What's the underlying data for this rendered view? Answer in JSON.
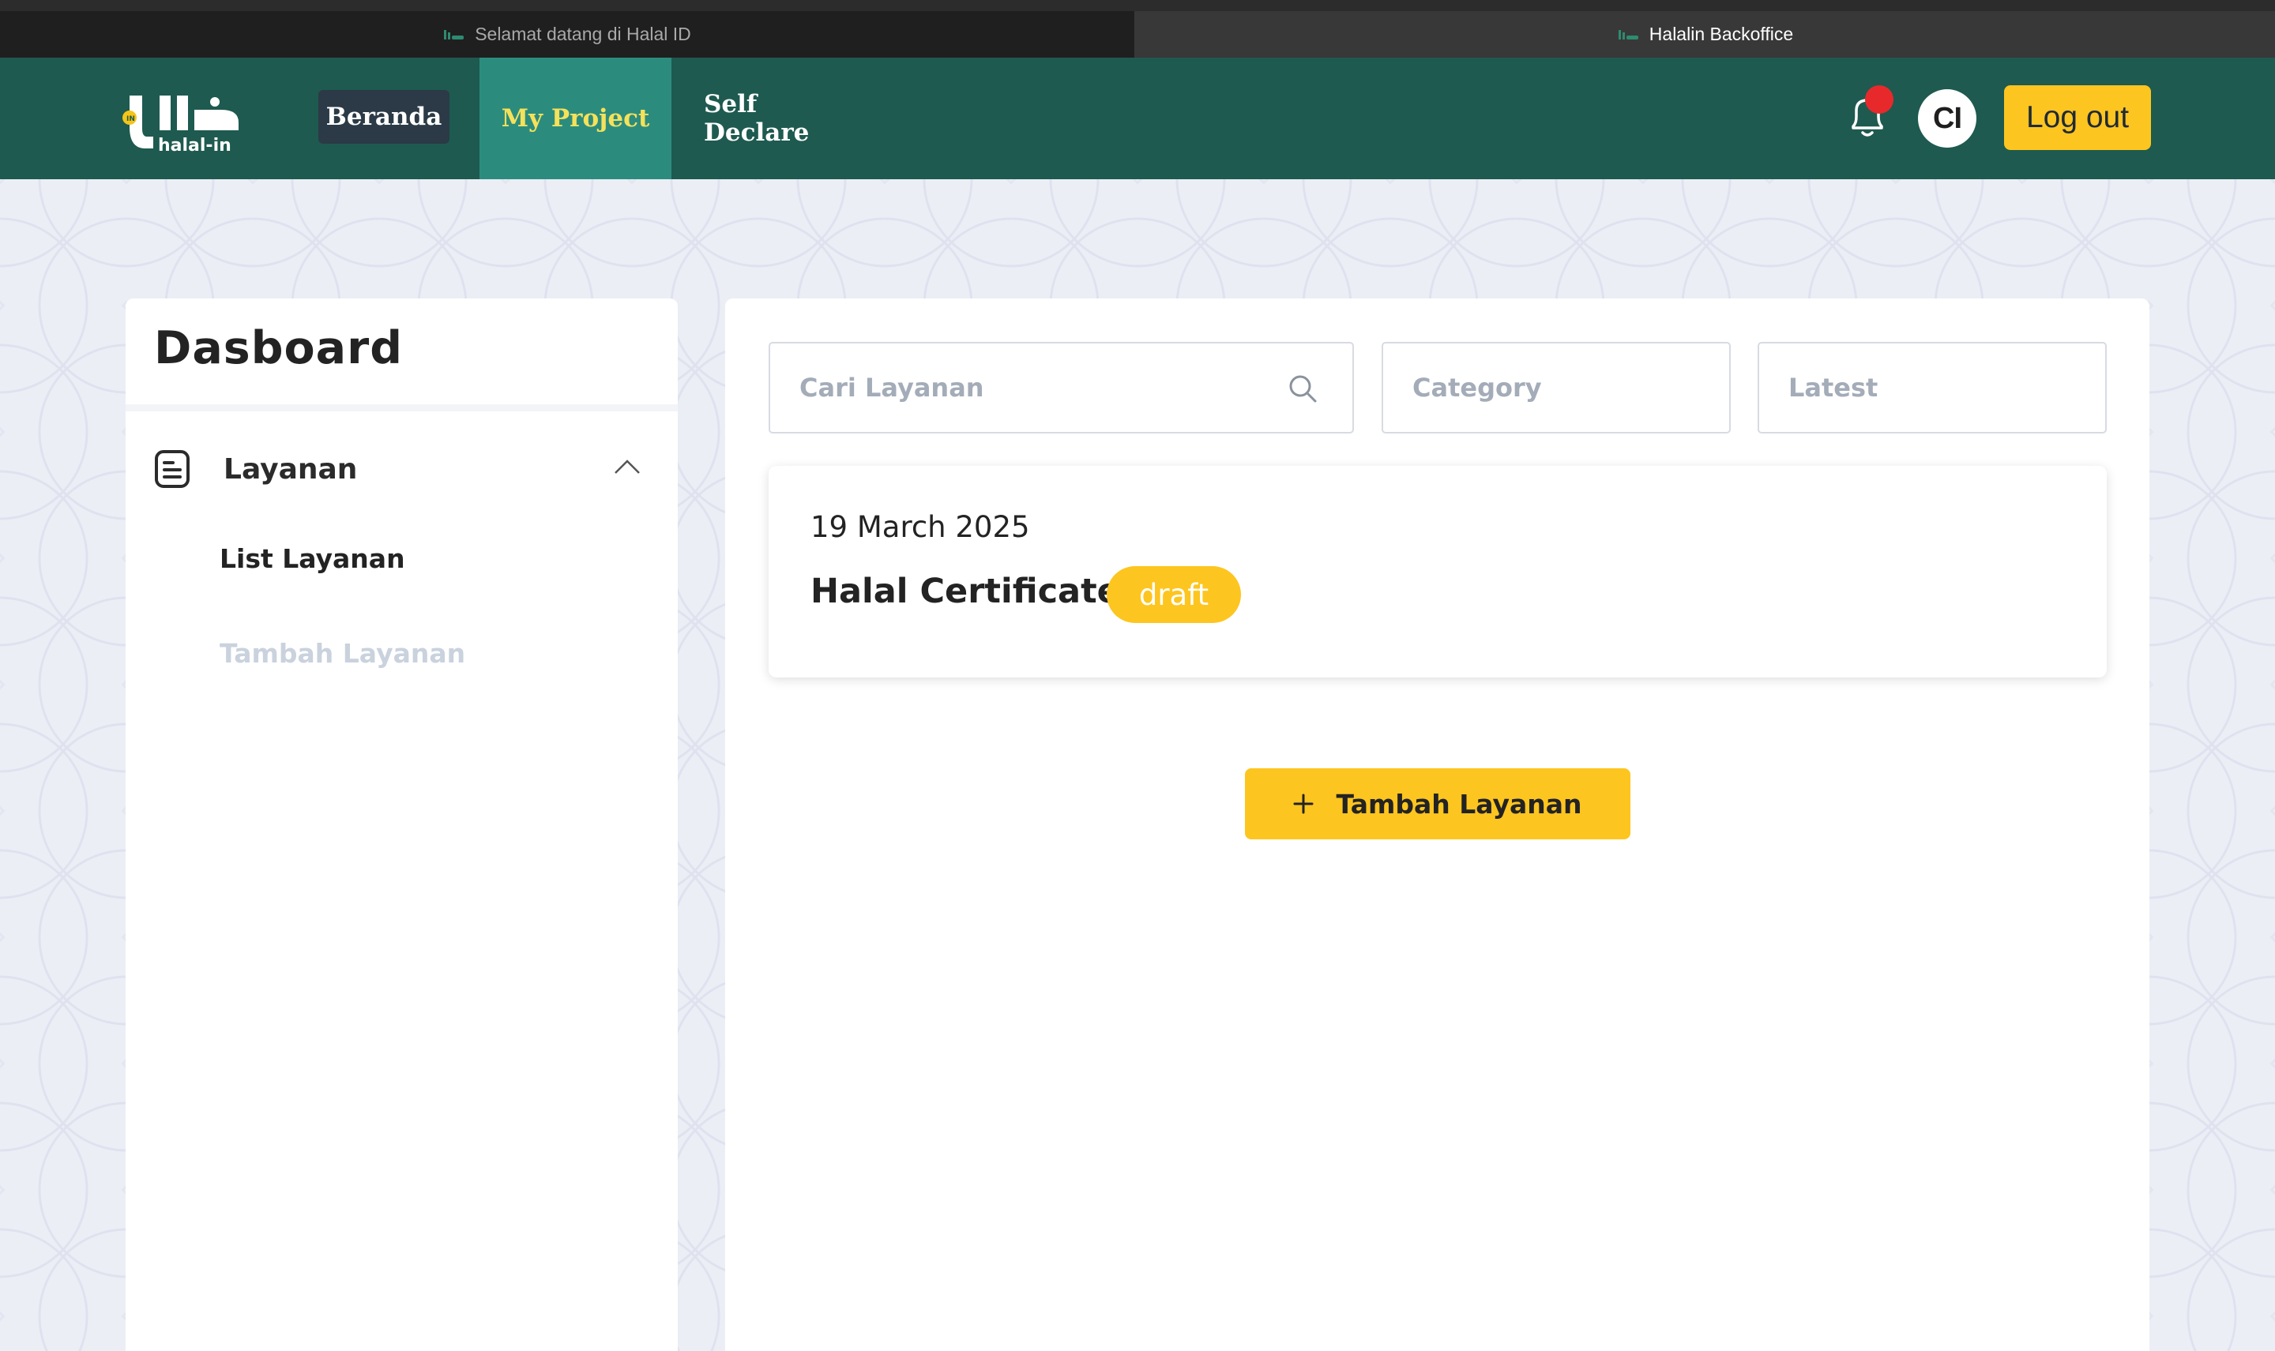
{
  "browser": {
    "tabs": [
      {
        "title": "Selamat datang di Halal ID",
        "active": false
      },
      {
        "title": "Halalin Backoffice",
        "active": true
      }
    ]
  },
  "header": {
    "logo_text": "halal-in",
    "nav": {
      "beranda": "Beranda",
      "my_project": "My Project",
      "self_declare": "Self Declare"
    },
    "notifications_icon": "bell-icon",
    "avatar_initials": "CI",
    "logout_label": "Log out"
  },
  "sidebar": {
    "title": "Dasboard",
    "group": {
      "icon": "document-icon",
      "label": "Layanan",
      "expanded": true,
      "items": [
        {
          "label": "List Layanan",
          "active": true
        },
        {
          "label": "Tambah Layanan",
          "active": false
        }
      ]
    }
  },
  "main": {
    "search": {
      "placeholder": "Cari Layanan"
    },
    "category": {
      "placeholder": "Category"
    },
    "sort": {
      "value": "Latest"
    },
    "services": [
      {
        "date": "19 March 2025",
        "title": "Halal Certificate",
        "status": "draft"
      }
    ],
    "add_button_label": "Tambah Layanan"
  },
  "colors": {
    "header_bg": "#1e5a4f",
    "active_nav_bg": "#2b8c7e",
    "active_nav_text": "#f5e15a",
    "accent_yellow": "#fdc51f",
    "notification_dot": "#e8292c"
  }
}
